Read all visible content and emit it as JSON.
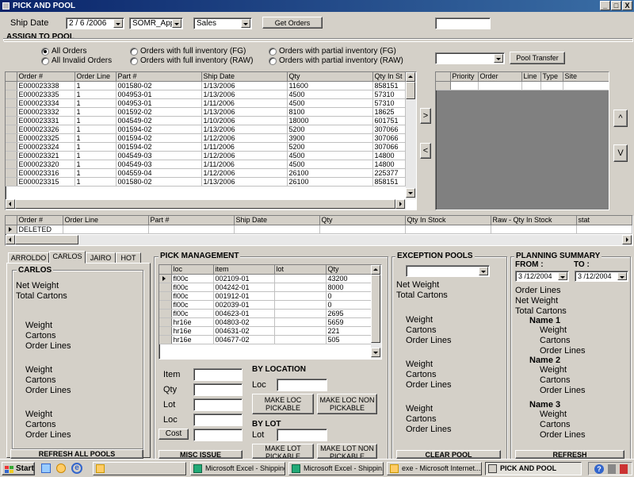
{
  "window": {
    "title": "PICK AND POOL",
    "min": "_",
    "max": "□",
    "close": "X"
  },
  "top": {
    "ship_date_label": "Ship Date",
    "ship_date_value": "2 / 6 /2006",
    "warehouse_value": "SOMR_App",
    "type_value": "Sales",
    "get_orders_label": "Get Orders",
    "right_field_value": ""
  },
  "assign": {
    "title": "ASSIGN TO POOL",
    "radios": [
      "All Orders",
      "All Invalid Orders",
      "Orders with full inventory (FG)",
      "Orders with full inventory (RAW)",
      "Orders with partial inventory (FG)",
      "Orders with partial inventory (RAW)"
    ],
    "pool_combo_value": "",
    "pool_transfer_label": "Pool Transfer"
  },
  "orders_grid": {
    "columns": [
      "Order #",
      "Order Line",
      "Part #",
      "Ship Date",
      "Qty",
      "Qty In St"
    ],
    "rows": [
      [
        "E000023338",
        "1",
        "001580-02",
        "1/13/2006",
        "11600",
        "858151"
      ],
      [
        "E000023335",
        "1",
        "004953-01",
        "1/13/2006",
        "4500",
        "57310"
      ],
      [
        "E000023334",
        "1",
        "004953-01",
        "1/11/2006",
        "4500",
        "57310"
      ],
      [
        "E000023332",
        "1",
        "001592-02",
        "1/13/2006",
        "8100",
        "18625"
      ],
      [
        "E000023331",
        "1",
        "004549-02",
        "1/10/2006",
        "18000",
        "601751"
      ],
      [
        "E000023326",
        "1",
        "001594-02",
        "1/13/2006",
        "5200",
        "307066"
      ],
      [
        "E000023325",
        "1",
        "001594-02",
        "1/12/2006",
        "3900",
        "307066"
      ],
      [
        "E000023324",
        "1",
        "001594-02",
        "1/11/2006",
        "5200",
        "307066"
      ],
      [
        "E000023321",
        "1",
        "004549-03",
        "1/12/2006",
        "4500",
        "14800"
      ],
      [
        "E000023320",
        "1",
        "004549-03",
        "1/11/2006",
        "4500",
        "14800"
      ],
      [
        "E000023316",
        "1",
        "004559-04",
        "1/12/2006",
        "26100",
        "225377"
      ],
      [
        "E000023315",
        "1",
        "001580-02",
        "1/13/2006",
        "26100",
        "858151"
      ]
    ]
  },
  "move": {
    "right": ">",
    "left": "<",
    "up": "^",
    "down": "V"
  },
  "pool_grid": {
    "columns": [
      "Priority",
      "Order",
      "Line",
      "Type",
      "Site"
    ]
  },
  "deleted_grid": {
    "columns": [
      "Order #",
      "Order Line",
      "Part #",
      "Ship Date",
      "Qty",
      "Qty In Stock",
      "Raw - Qty In Stock",
      "stat"
    ],
    "rows": [
      [
        "DELETED",
        "",
        "",
        "",
        "",
        "",
        "",
        ""
      ]
    ]
  },
  "tabs": [
    "ARROLDO",
    "CARLOS",
    "JAIRO",
    "HOT"
  ],
  "carlos": {
    "title": "CARLOS",
    "net_weight": "Net Weight",
    "total_cartons": "Total Cartons",
    "groups": [
      [
        "Weight",
        "Cartons",
        "Order Lines"
      ],
      [
        "Weight",
        "Cartons",
        "Order Lines"
      ],
      [
        "Weight",
        "Cartons",
        "Order Lines"
      ]
    ],
    "refresh_label": "REFRESH ALL POOLS"
  },
  "pick": {
    "title": "PICK MANAGEMENT",
    "columns": [
      "loc",
      "item",
      "lot",
      "Qty"
    ],
    "rows": [
      [
        "fl00c",
        "002109-01",
        "",
        "43200"
      ],
      [
        "fl00c",
        "004242-01",
        "",
        "8000"
      ],
      [
        "fl00c",
        "001912-01",
        "",
        "0"
      ],
      [
        "fl00c",
        "002039-01",
        "",
        "0"
      ],
      [
        "fl00c",
        "004623-01",
        "",
        "2695"
      ],
      [
        "hr16e",
        "004803-02",
        "",
        "5659"
      ],
      [
        "hr16e",
        "004631-02",
        "",
        "221"
      ],
      [
        "hr16e",
        "004677-02",
        "",
        "505"
      ]
    ],
    "item_label": "Item",
    "qty_label": "Qty",
    "lot_label": "Lot",
    "loc_label": "Loc",
    "cost_label": "Cost",
    "by_location": "BY LOCATION",
    "loc2_label": "Loc",
    "make_loc_pickable": "MAKE LOC PICKABLE",
    "make_loc_non_pickable": "MAKE LOC NON PICKABLE",
    "by_lot": "BY LOT",
    "lot2_label": "Lot",
    "make_lot_pickable": "MAKE LOT PICKABLE",
    "make_lot_non_pickable": "MAKE LOT NON PICKABLE",
    "misc_issue": "MISC ISSUE"
  },
  "exception": {
    "title": "EXCEPTION POOLS",
    "combo_value": "",
    "net_weight": "Net Weight",
    "total_cartons": "Total Cartons",
    "groups": [
      [
        "Weight",
        "Cartons",
        "Order Lines"
      ],
      [
        "Weight",
        "Cartons",
        "Order Lines"
      ],
      [
        "Weight",
        "Cartons",
        "Order Lines"
      ]
    ],
    "clear_pool": "CLEAR POOL"
  },
  "planning": {
    "title": "PLANNING SUMMARY",
    "from_label": "FROM :",
    "to_label": "TO :",
    "from_value": "3 /12/2004",
    "to_value": "3 /12/2004",
    "order_lines": "Order Lines",
    "net_weight": "Net Weight",
    "total_cartons": "Total Cartons",
    "names": [
      {
        "name": "Name 1",
        "items": [
          "Weight",
          "Cartons",
          "Order Lines"
        ]
      },
      {
        "name": "Name 2",
        "items": [
          "Weight",
          "Cartons",
          "Order Lines"
        ]
      },
      {
        "name": "Name 3",
        "items": [
          "Weight",
          "Cartons",
          "Order Lines"
        ]
      }
    ],
    "refresh": "REFRESH"
  },
  "taskbar": {
    "start": "Start",
    "tasks": [
      "Microsoft Excel - Shipping",
      "Microsoft Excel - Shippin...",
      "exe - Microsoft Internet...",
      "PICK AND POOL"
    ]
  },
  "colors": {
    "title_start": "#0a246a",
    "title_end": "#3a6ea5",
    "face": "#d4d0c8"
  }
}
